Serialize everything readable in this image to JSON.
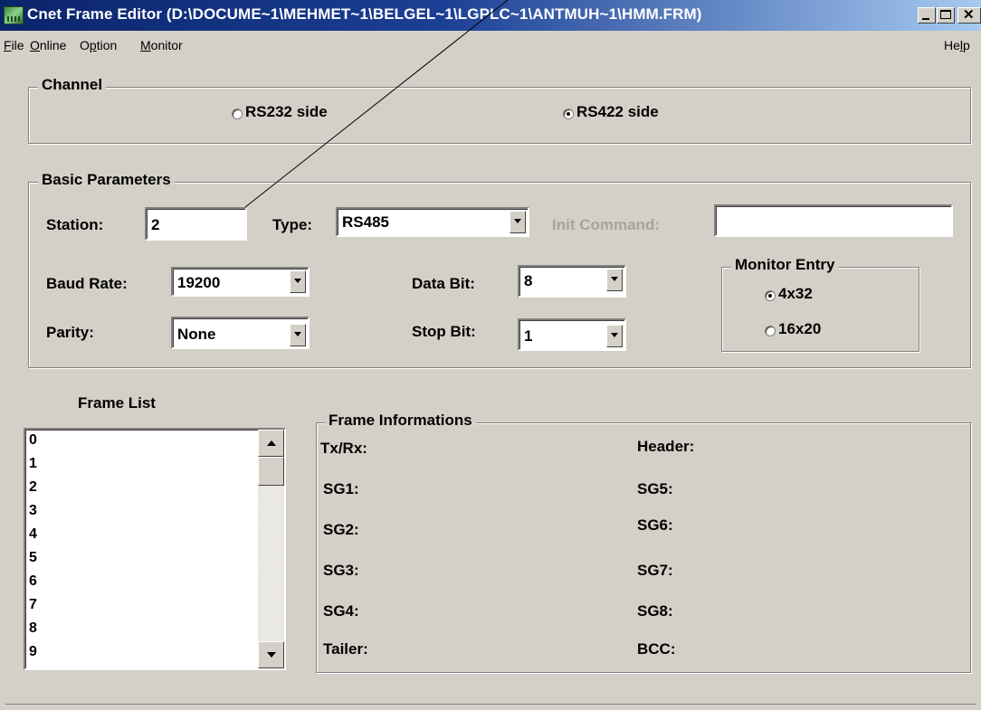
{
  "window": {
    "title": "Cnet Frame Editor (D:\\DOCUME~1\\MEHMET~1\\BELGEL~1\\LGPLC~1\\ANTMUH~1\\HMM.FRM)",
    "icon": "plc-app-icon",
    "controls": [
      "minimize",
      "maximize",
      "close"
    ]
  },
  "menu": {
    "items": [
      {
        "label": "File",
        "accel": "F"
      },
      {
        "label": "Online",
        "accel": "O"
      },
      {
        "label": "Option",
        "accel": "p"
      },
      {
        "label": "Monitor",
        "accel": "M"
      }
    ],
    "help": {
      "label": "Help",
      "accel": "l"
    }
  },
  "channel": {
    "title": "Channel",
    "options": [
      {
        "label": "RS232 side",
        "checked": false
      },
      {
        "label": "RS422 side",
        "checked": true
      }
    ]
  },
  "basic": {
    "title": "Basic Parameters",
    "station_label": "Station:",
    "station_value": "2",
    "type_label": "Type:",
    "type_value": "RS485",
    "init_label": "Init Command:",
    "init_value": "",
    "baud_label": "Baud Rate:",
    "baud_value": "19200",
    "databit_label": "Data Bit:",
    "databit_value": "8",
    "parity_label": "Parity:",
    "parity_value": "None",
    "stopbit_label": "Stop Bit:",
    "stopbit_value": "1",
    "monitor_entry": {
      "title": "Monitor Entry",
      "options": [
        {
          "label": "4x32",
          "checked": true
        },
        {
          "label": "16x20",
          "checked": false
        }
      ]
    }
  },
  "frame_list": {
    "title": "Frame List",
    "items": [
      "0",
      "1",
      "2",
      "3",
      "4",
      "5",
      "6",
      "7",
      "8",
      "9"
    ]
  },
  "frame_info": {
    "title": "Frame Informations",
    "left": [
      "Tx/Rx:",
      "SG1:",
      "SG2:",
      "SG3:",
      "SG4:",
      "Tailer:"
    ],
    "right": [
      "Header:",
      "SG5:",
      "SG6:",
      "SG7:",
      "SG8:",
      "BCC:"
    ]
  }
}
